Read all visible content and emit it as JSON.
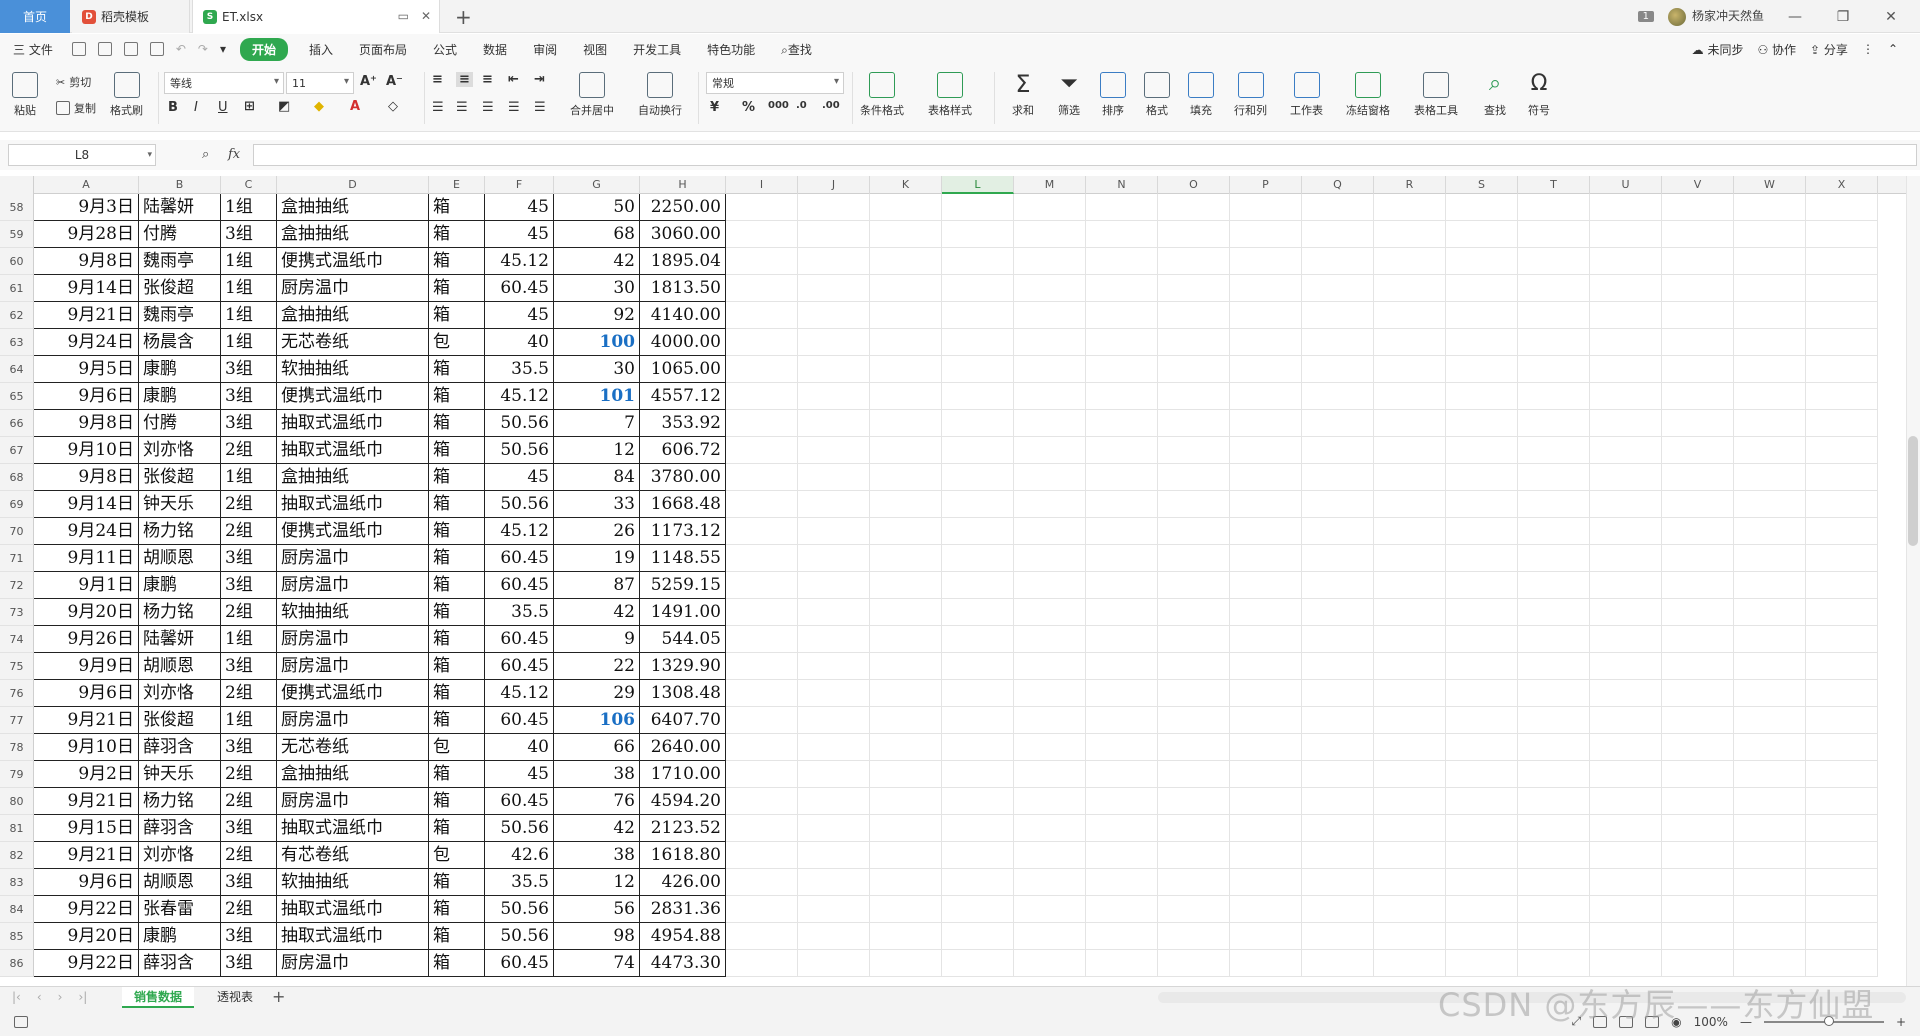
{
  "tabs": {
    "home": "首页",
    "docer": "稻壳模板",
    "file": "ET.xlsx"
  },
  "window": {
    "badge": "1",
    "user": "杨家冲天然鱼"
  },
  "menu": {
    "file": "三 文件",
    "items": [
      "开始",
      "插入",
      "页面布局",
      "公式",
      "数据",
      "审阅",
      "视图",
      "开发工具",
      "特色功能"
    ],
    "search": "查找",
    "right": [
      "未同步",
      "协作",
      "分享"
    ]
  },
  "ribbon": {
    "paste": "粘贴",
    "cut": "剪切",
    "copy": "复制",
    "format_painter": "格式刷",
    "font_name": "等线",
    "font_size": "11",
    "merge": "合并居中",
    "wrap": "自动换行",
    "number_format": "常规",
    "cond_format": "条件格式",
    "table_style": "表格样式",
    "sum": "求和",
    "filter": "筛选",
    "sort": "排序",
    "format": "格式",
    "fill": "填充",
    "row_col": "行和列",
    "worksheet": "工作表",
    "freeze": "冻结窗格",
    "table_tools": "表格工具",
    "find": "查找",
    "symbol": "符号",
    "bold": "B",
    "italic": "I",
    "underline": "U"
  },
  "formula_bar": {
    "name_box": "L8",
    "fx": "fx",
    "value": ""
  },
  "columns": [
    "A",
    "B",
    "C",
    "D",
    "E",
    "F",
    "G",
    "H",
    "I",
    "J",
    "K",
    "L",
    "M",
    "N",
    "O",
    "P",
    "Q",
    "R",
    "S",
    "T",
    "U",
    "V",
    "W",
    "X"
  ],
  "selected_column": "L",
  "rows": [
    {
      "n": "58",
      "a": "9月3日",
      "b": "陆馨妍",
      "c": "1组",
      "d": "盒抽抽纸",
      "e": "箱",
      "f": "45",
      "g": "50",
      "h": "2250.00",
      "hl": false
    },
    {
      "n": "59",
      "a": "9月28日",
      "b": "付腾",
      "c": "3组",
      "d": "盒抽抽纸",
      "e": "箱",
      "f": "45",
      "g": "68",
      "h": "3060.00",
      "hl": false
    },
    {
      "n": "60",
      "a": "9月8日",
      "b": "魏雨亭",
      "c": "1组",
      "d": "便携式温纸巾",
      "e": "箱",
      "f": "45.12",
      "g": "42",
      "h": "1895.04",
      "hl": false
    },
    {
      "n": "61",
      "a": "9月14日",
      "b": "张俊超",
      "c": "1组",
      "d": "厨房温巾",
      "e": "箱",
      "f": "60.45",
      "g": "30",
      "h": "1813.50",
      "hl": false
    },
    {
      "n": "62",
      "a": "9月21日",
      "b": "魏雨亭",
      "c": "1组",
      "d": "盒抽抽纸",
      "e": "箱",
      "f": "45",
      "g": "92",
      "h": "4140.00",
      "hl": false
    },
    {
      "n": "63",
      "a": "9月24日",
      "b": "杨晨含",
      "c": "1组",
      "d": "无芯卷纸",
      "e": "包",
      "f": "40",
      "g": "100",
      "h": "4000.00",
      "hl": true
    },
    {
      "n": "64",
      "a": "9月5日",
      "b": "康鹏",
      "c": "3组",
      "d": "软抽抽纸",
      "e": "箱",
      "f": "35.5",
      "g": "30",
      "h": "1065.00",
      "hl": false
    },
    {
      "n": "65",
      "a": "9月6日",
      "b": "康鹏",
      "c": "3组",
      "d": "便携式温纸巾",
      "e": "箱",
      "f": "45.12",
      "g": "101",
      "h": "4557.12",
      "hl": true
    },
    {
      "n": "66",
      "a": "9月8日",
      "b": "付腾",
      "c": "3组",
      "d": "抽取式温纸巾",
      "e": "箱",
      "f": "50.56",
      "g": "7",
      "h": "353.92",
      "hl": false
    },
    {
      "n": "67",
      "a": "9月10日",
      "b": "刘亦恪",
      "c": "2组",
      "d": "抽取式温纸巾",
      "e": "箱",
      "f": "50.56",
      "g": "12",
      "h": "606.72",
      "hl": false
    },
    {
      "n": "68",
      "a": "9月8日",
      "b": "张俊超",
      "c": "1组",
      "d": "盒抽抽纸",
      "e": "箱",
      "f": "45",
      "g": "84",
      "h": "3780.00",
      "hl": false
    },
    {
      "n": "69",
      "a": "9月14日",
      "b": "钟天乐",
      "c": "2组",
      "d": "抽取式温纸巾",
      "e": "箱",
      "f": "50.56",
      "g": "33",
      "h": "1668.48",
      "hl": false
    },
    {
      "n": "70",
      "a": "9月24日",
      "b": "杨力铭",
      "c": "2组",
      "d": "便携式温纸巾",
      "e": "箱",
      "f": "45.12",
      "g": "26",
      "h": "1173.12",
      "hl": false
    },
    {
      "n": "71",
      "a": "9月11日",
      "b": "胡顺恩",
      "c": "3组",
      "d": "厨房温巾",
      "e": "箱",
      "f": "60.45",
      "g": "19",
      "h": "1148.55",
      "hl": false
    },
    {
      "n": "72",
      "a": "9月1日",
      "b": "康鹏",
      "c": "3组",
      "d": "厨房温巾",
      "e": "箱",
      "f": "60.45",
      "g": "87",
      "h": "5259.15",
      "hl": false
    },
    {
      "n": "73",
      "a": "9月20日",
      "b": "杨力铭",
      "c": "2组",
      "d": "软抽抽纸",
      "e": "箱",
      "f": "35.5",
      "g": "42",
      "h": "1491.00",
      "hl": false
    },
    {
      "n": "74",
      "a": "9月26日",
      "b": "陆馨妍",
      "c": "1组",
      "d": "厨房温巾",
      "e": "箱",
      "f": "60.45",
      "g": "9",
      "h": "544.05",
      "hl": false
    },
    {
      "n": "75",
      "a": "9月9日",
      "b": "胡顺恩",
      "c": "3组",
      "d": "厨房温巾",
      "e": "箱",
      "f": "60.45",
      "g": "22",
      "h": "1329.90",
      "hl": false
    },
    {
      "n": "76",
      "a": "9月6日",
      "b": "刘亦恪",
      "c": "2组",
      "d": "便携式温纸巾",
      "e": "箱",
      "f": "45.12",
      "g": "29",
      "h": "1308.48",
      "hl": false
    },
    {
      "n": "77",
      "a": "9月21日",
      "b": "张俊超",
      "c": "1组",
      "d": "厨房温巾",
      "e": "箱",
      "f": "60.45",
      "g": "106",
      "h": "6407.70",
      "hl": true
    },
    {
      "n": "78",
      "a": "9月10日",
      "b": "薛羽含",
      "c": "3组",
      "d": "无芯卷纸",
      "e": "包",
      "f": "40",
      "g": "66",
      "h": "2640.00",
      "hl": false
    },
    {
      "n": "79",
      "a": "9月2日",
      "b": "钟天乐",
      "c": "2组",
      "d": "盒抽抽纸",
      "e": "箱",
      "f": "45",
      "g": "38",
      "h": "1710.00",
      "hl": false
    },
    {
      "n": "80",
      "a": "9月21日",
      "b": "杨力铭",
      "c": "2组",
      "d": "厨房温巾",
      "e": "箱",
      "f": "60.45",
      "g": "76",
      "h": "4594.20",
      "hl": false
    },
    {
      "n": "81",
      "a": "9月15日",
      "b": "薛羽含",
      "c": "3组",
      "d": "抽取式温纸巾",
      "e": "箱",
      "f": "50.56",
      "g": "42",
      "h": "2123.52",
      "hl": false
    },
    {
      "n": "82",
      "a": "9月21日",
      "b": "刘亦恪",
      "c": "2组",
      "d": "有芯卷纸",
      "e": "包",
      "f": "42.6",
      "g": "38",
      "h": "1618.80",
      "hl": false
    },
    {
      "n": "83",
      "a": "9月6日",
      "b": "胡顺恩",
      "c": "3组",
      "d": "软抽抽纸",
      "e": "箱",
      "f": "35.5",
      "g": "12",
      "h": "426.00",
      "hl": false
    },
    {
      "n": "84",
      "a": "9月22日",
      "b": "张春雷",
      "c": "2组",
      "d": "抽取式温纸巾",
      "e": "箱",
      "f": "50.56",
      "g": "56",
      "h": "2831.36",
      "hl": false
    },
    {
      "n": "85",
      "a": "9月20日",
      "b": "康鹏",
      "c": "3组",
      "d": "抽取式温纸巾",
      "e": "箱",
      "f": "50.56",
      "g": "98",
      "h": "4954.88",
      "hl": false
    },
    {
      "n": "86",
      "a": "9月22日",
      "b": "薛羽含",
      "c": "3组",
      "d": "厨房温巾",
      "e": "箱",
      "f": "60.45",
      "g": "74",
      "h": "4473.30",
      "hl": false
    }
  ],
  "sheets": [
    "销售数据",
    "透视表"
  ],
  "active_sheet": "销售数据",
  "status": {
    "zoom": "100%"
  },
  "watermark": "CSDN @东方辰——东方仙盟",
  "colors": {
    "accent": "#2fa84f",
    "highlight_number": "#1a6fc4",
    "home_tab": "#4a90d9"
  }
}
